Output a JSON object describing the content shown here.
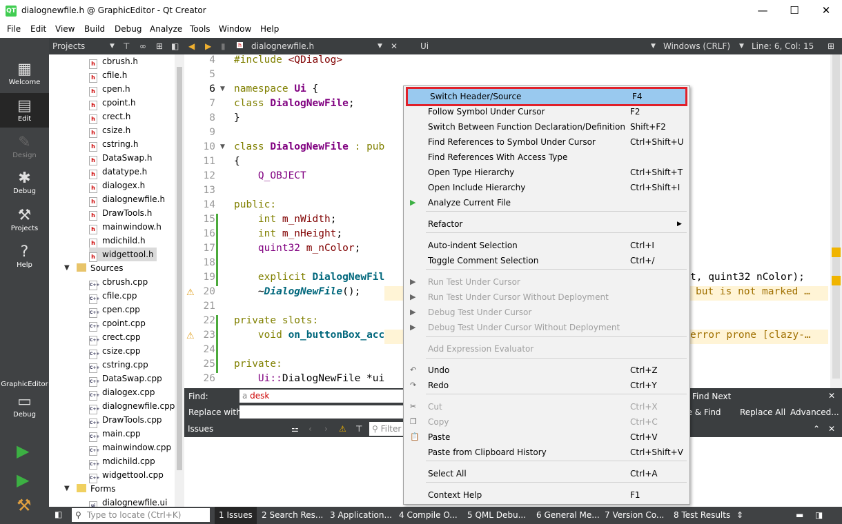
{
  "window": {
    "title": "dialognewfile.h @ GraphicEditor - Qt Creator",
    "logo": "QT",
    "minimize": "—",
    "maximize": "☐",
    "close": "✕"
  },
  "menubar": [
    "File",
    "Edit",
    "View",
    "Build",
    "Debug",
    "Analyze",
    "Tools",
    "Window",
    "Help"
  ],
  "modes": [
    {
      "label": "Welcome",
      "icon": "grid-icon"
    },
    {
      "label": "Edit",
      "icon": "document-icon"
    },
    {
      "label": "Design",
      "icon": "pencil-icon"
    },
    {
      "label": "Debug",
      "icon": "bug-icon"
    },
    {
      "label": "Projects",
      "icon": "wrench-icon"
    },
    {
      "label": "Help",
      "icon": "question-icon"
    }
  ],
  "kit": {
    "project": "GraphicEditor",
    "label": "Debug"
  },
  "toolbar": {
    "projects": "Projects",
    "file_tab": "dialognewfile.h",
    "symbol": "Ui",
    "line_ending": "Windows (CRLF)",
    "position": "Line: 6, Col: 15"
  },
  "tree": {
    "headers": [
      "cbrush.h",
      "cfile.h",
      "cpen.h",
      "cpoint.h",
      "crect.h",
      "csize.h",
      "cstring.h",
      "DataSwap.h",
      "datatype.h",
      "dialogex.h",
      "dialognewfile.h",
      "DrawTools.h",
      "mainwindow.h",
      "mdichild.h",
      "widgettool.h"
    ],
    "sources_label": "Sources",
    "sources": [
      "cbrush.cpp",
      "cfile.cpp",
      "cpen.cpp",
      "cpoint.cpp",
      "crect.cpp",
      "csize.cpp",
      "cstring.cpp",
      "DataSwap.cpp",
      "dialogex.cpp",
      "dialognewfile.cpp",
      "DrawTools.cpp",
      "main.cpp",
      "mainwindow.cpp",
      "mdichild.cpp",
      "widgettool.cpp"
    ],
    "forms_label": "Forms",
    "forms": [
      "dialognewfile.ui"
    ]
  },
  "code": {
    "line_numbers": [
      "4",
      "5",
      "6",
      "7",
      "8",
      "9",
      "10",
      "11",
      "12",
      "13",
      "14",
      "15",
      "16",
      "17",
      "18",
      "19",
      "20",
      "21",
      "22",
      "23",
      "24",
      "25",
      "26"
    ],
    "l4a": "#include ",
    "l4b": "<QDialog>",
    "l6a": "namespace ",
    "l6b": "Ui",
    " l6c": " {",
    "l7a": "class ",
    "l7b": "DialogNewFile",
    "l7c": ";",
    "l8": "}",
    "l10a": "class ",
    "l10b": "DialogNewFile",
    "l10c": " : pub",
    "l11": "{",
    "l12": "    Q_OBJECT",
    "l14": "public:",
    "l15a": "    int ",
    "l15b": "m_nWidth",
    "l15c": ";",
    "l16a": "    int ",
    "l16b": "m_nHeight",
    "l16c": ";",
    "l17a": "    quint32 ",
    "l17b": "m_nColor",
    "l17c": ";",
    "l19a": "    explicit ",
    "l19b": "DialogNewFil",
    "l19tail": "t, quint32 nColor);",
    "l20a": "    ~",
    "l20b": "DialogNewFile",
    "l20c": "();",
    "l20warn": "but is not marked …",
    "l22": "private slots:",
    "l23a": "    void ",
    "l23b": "on_buttonBox_acc",
    "l23warn": "error prone [clazy-…",
    "l25": "private:",
    "l26a": "    Ui::",
    "l26b": "DialogNewFile *ui"
  },
  "find": {
    "find_label": "Find:",
    "find_value": "desk",
    "replace_label": "Replace with:",
    "find_next": "Find Next",
    "replace_find": "ce & Find",
    "replace_all": "Replace All",
    "advanced": "Advanced...",
    "close": "✕"
  },
  "issues": {
    "title": "Issues",
    "filter_placeholder": "Filter"
  },
  "status": {
    "locate_placeholder": "Type to locate (Ctrl+K)",
    "tabs": [
      "1  Issues",
      "2  Search Res...",
      "3  Application...",
      "4  Compile O...",
      "5  QML Debu...",
      "6  General Me...",
      "7  Version Co...",
      "8  Test Results"
    ]
  },
  "context_menu": [
    {
      "label": "Switch Header/Source",
      "shortcut": "F4",
      "highlight": true
    },
    {
      "label": "Follow Symbol Under Cursor",
      "shortcut": "F2"
    },
    {
      "label": "Switch Between Function Declaration/Definition",
      "shortcut": "Shift+F2"
    },
    {
      "label": "Find References to Symbol Under Cursor",
      "shortcut": "Ctrl+Shift+U"
    },
    {
      "label": "Find References With Access Type",
      "shortcut": ""
    },
    {
      "label": "Open Type Hierarchy",
      "shortcut": "Ctrl+Shift+T"
    },
    {
      "label": "Open Include Hierarchy",
      "shortcut": "Ctrl+Shift+I"
    },
    {
      "label": "Analyze Current File",
      "shortcut": ""
    },
    {
      "label": "Refactor",
      "shortcut": ""
    },
    {
      "label": "Auto-indent Selection",
      "shortcut": "Ctrl+I"
    },
    {
      "label": "Toggle Comment Selection",
      "shortcut": "Ctrl+/"
    },
    {
      "label": "Run Test Under Cursor",
      "shortcut": "",
      "disabled": true
    },
    {
      "label": "Run Test Under Cursor Without Deployment",
      "shortcut": "",
      "disabled": true
    },
    {
      "label": "Debug Test Under Cursor",
      "shortcut": "",
      "disabled": true
    },
    {
      "label": "Debug Test Under Cursor Without Deployment",
      "shortcut": "",
      "disabled": true
    },
    {
      "label": "Add Expression Evaluator",
      "shortcut": "",
      "disabled": true
    },
    {
      "label": "Undo",
      "shortcut": "Ctrl+Z"
    },
    {
      "label": "Redo",
      "shortcut": "Ctrl+Y"
    },
    {
      "label": "Cut",
      "shortcut": "Ctrl+X",
      "disabled": true
    },
    {
      "label": "Copy",
      "shortcut": "Ctrl+C",
      "disabled": true
    },
    {
      "label": "Paste",
      "shortcut": "Ctrl+V"
    },
    {
      "label": "Paste from Clipboard History",
      "shortcut": "Ctrl+Shift+V"
    },
    {
      "label": "Select All",
      "shortcut": "Ctrl+A"
    },
    {
      "label": "Context Help",
      "shortcut": "F1"
    }
  ],
  "colors": {
    "highlight": "#99c9ef",
    "highlight_border": "#e0202a",
    "sidebar": "#404244"
  }
}
